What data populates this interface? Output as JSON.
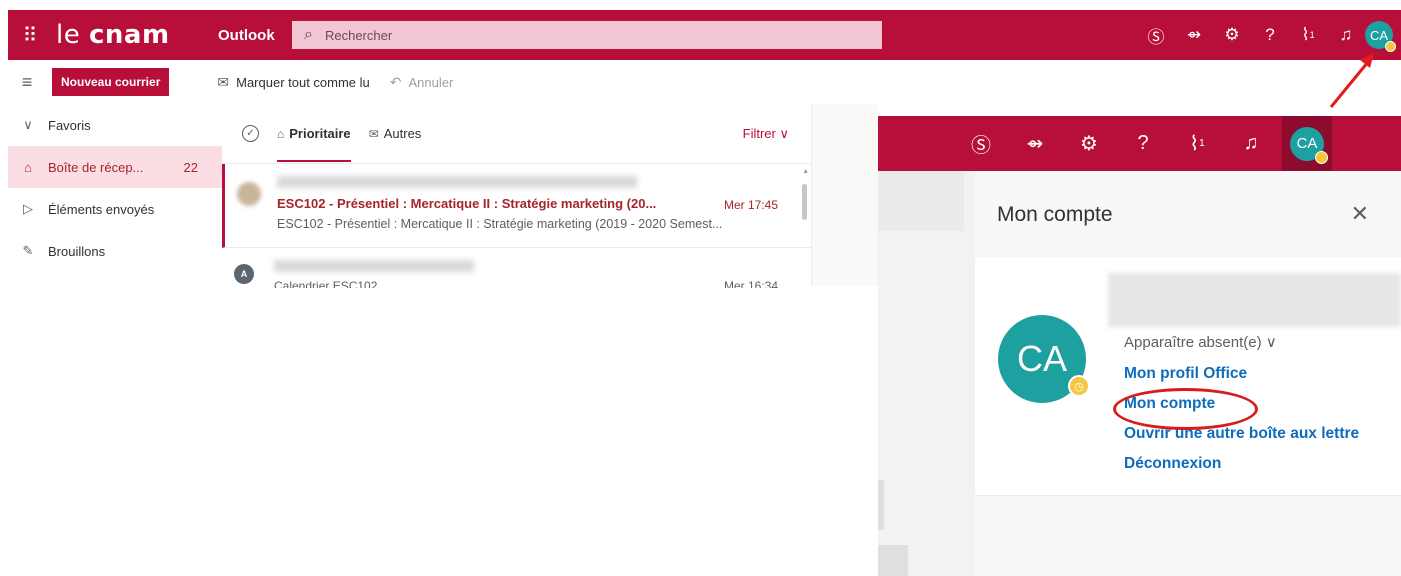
{
  "header": {
    "waffle_icon": "app-launcher-icon",
    "logo_prefix": "le ",
    "logo_bold": "cnam",
    "app_name": "Outlook",
    "search_placeholder": "Rechercher",
    "avatar_initials": "CA",
    "brand_color": "#b80e3a",
    "avatar_color": "#1e9fa0",
    "icons": [
      "skype-icon",
      "to-do-icon",
      "settings-icon",
      "help-icon",
      "whats-new-icon",
      "notifications-icon"
    ],
    "whats_new_count": "1"
  },
  "commands": {
    "new_mail": "Nouveau courrier",
    "mark_all_read": "Marquer tout comme lu",
    "undo": "Annuler"
  },
  "folders": [
    {
      "label": "Favoris",
      "icon": "chevron-down-icon"
    },
    {
      "label": "Boîte de récep...",
      "count": "22",
      "icon": "inbox-icon"
    },
    {
      "label": "Éléments envoyés",
      "icon": "sent-icon"
    },
    {
      "label": "Brouillons",
      "icon": "pencil-icon"
    }
  ],
  "message_list": {
    "tab_focused": "Prioritaire",
    "tab_other": "Autres",
    "filter": "Filtrer",
    "messages": [
      {
        "subject": "ESC102 - Présentiel : Mercatique II : Stratégie marketing (20...",
        "time": "Mer 17:45",
        "preview": "ESC102 - Présentiel : Mercatique II : Stratégie marketing (2019 - 2020 Semest..."
      },
      {
        "avatar_initial": "A",
        "subject": "Calendrier ESC102",
        "time": "Mer 16:34"
      }
    ]
  },
  "account_panel": {
    "title": "Mon compte",
    "avatar_initials": "CA",
    "status": "Apparaître absent(e)",
    "links": [
      "Mon profil Office",
      "Mon compte",
      "Ouvrir une autre boîte aux lettre",
      "Déconnexion"
    ],
    "highlighted_link": "Mon compte",
    "link_color": "#0f6cbd",
    "annotation_color": "#d81b1b"
  }
}
